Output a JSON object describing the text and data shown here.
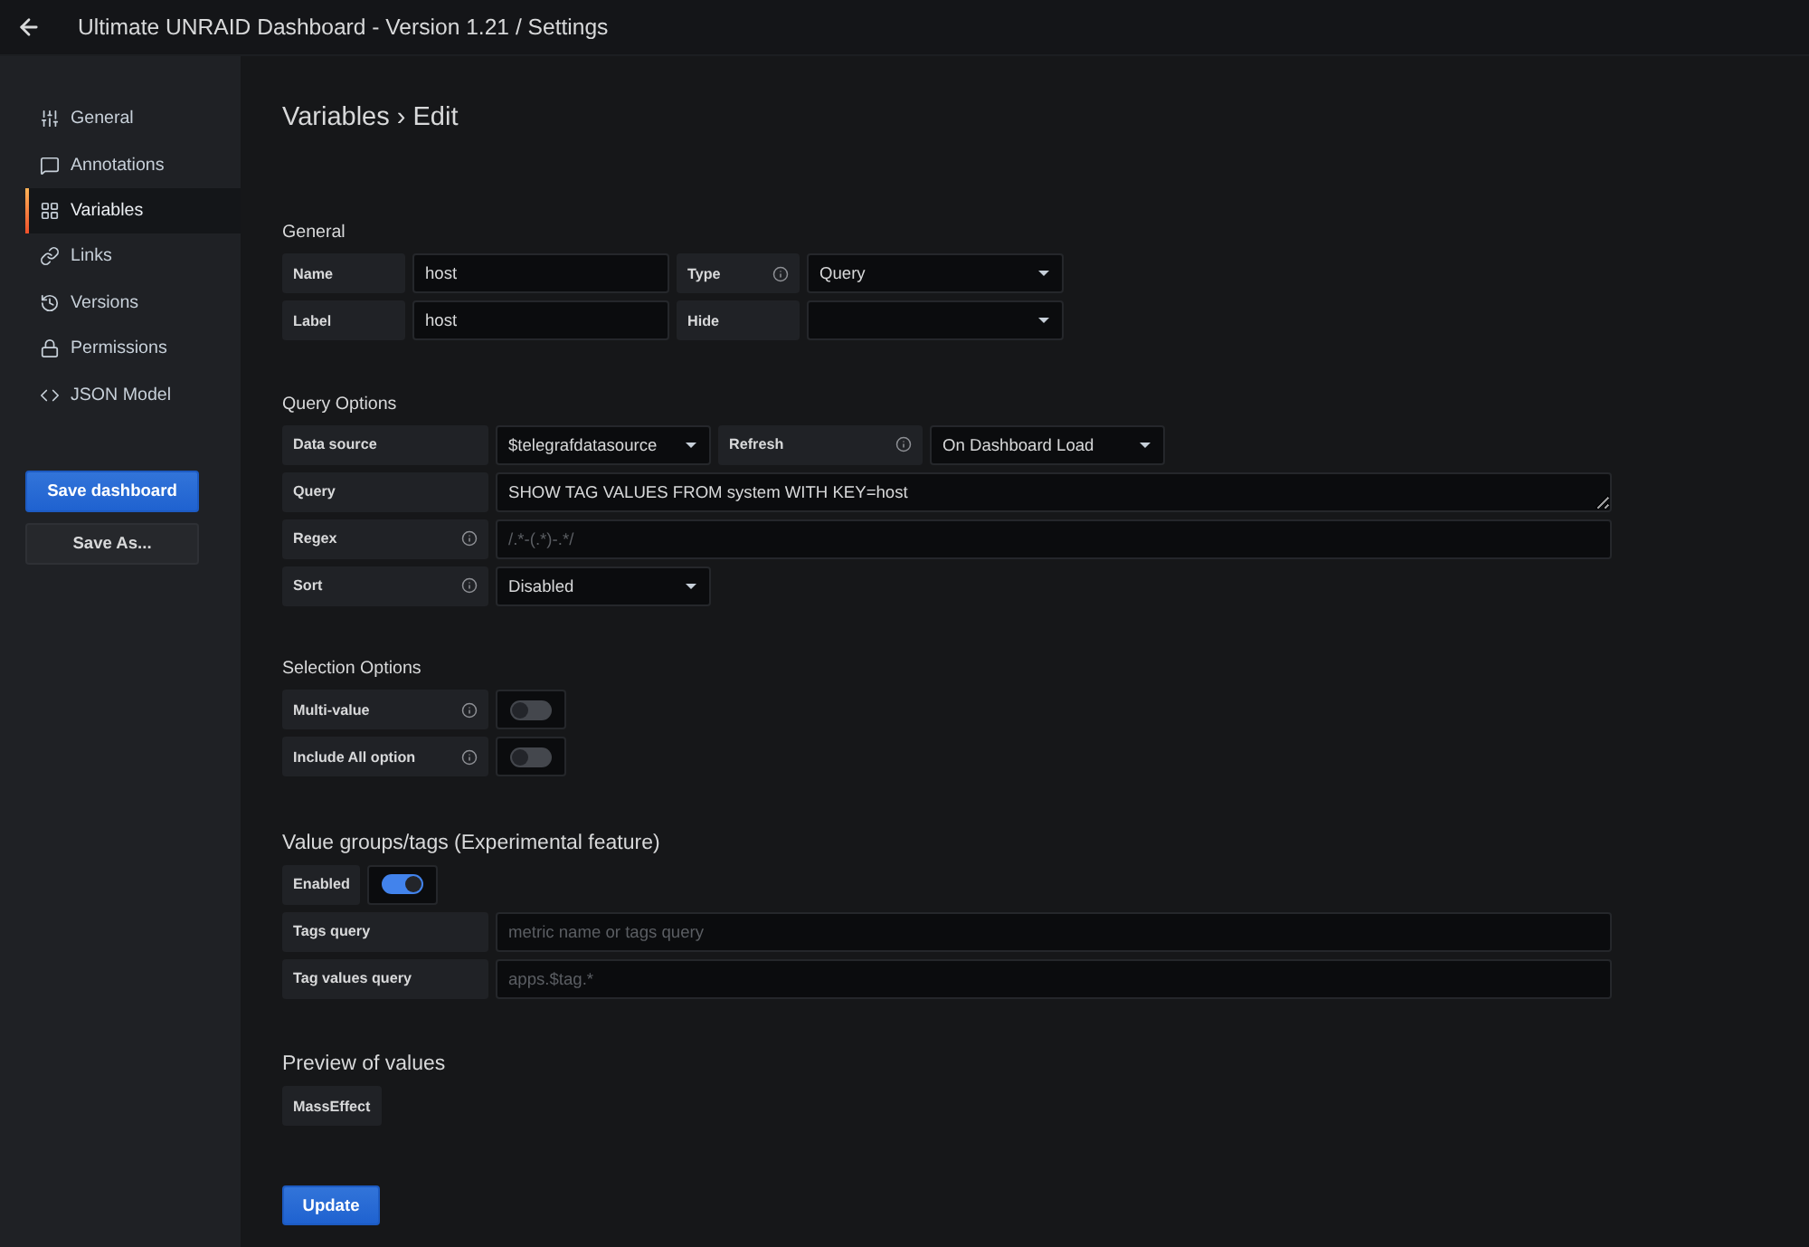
{
  "header": {
    "title": "Ultimate UNRAID Dashboard - Version 1.21 / Settings"
  },
  "sidebar": {
    "items": [
      {
        "label": "General",
        "selected": false
      },
      {
        "label": "Annotations",
        "selected": false
      },
      {
        "label": "Variables",
        "selected": true
      },
      {
        "label": "Links",
        "selected": false
      },
      {
        "label": "Versions",
        "selected": false
      },
      {
        "label": "Permissions",
        "selected": false
      },
      {
        "label": "JSON Model",
        "selected": false
      }
    ],
    "actions": [
      {
        "label": "Save dashboard",
        "kind": "primary"
      },
      {
        "label": "Save As...",
        "kind": "secondary"
      }
    ]
  },
  "page_title": "Variables › Edit",
  "sections": [
    {
      "title": "General",
      "rows": [
        {
          "fields": [
            {
              "kind": "label",
              "text": "Name",
              "info": false
            },
            {
              "kind": "input",
              "value": "host"
            },
            {
              "kind": "label",
              "text": "Type",
              "info": true
            },
            {
              "kind": "select",
              "value": "Query"
            }
          ]
        },
        {
          "fields": [
            {
              "kind": "label",
              "text": "Label",
              "info": false
            },
            {
              "kind": "input",
              "value": "host"
            },
            {
              "kind": "label",
              "text": "Hide",
              "info": false
            },
            {
              "kind": "select"
            }
          ]
        }
      ]
    },
    {
      "title": "Query Options",
      "rows": [
        {
          "fields": [
            {
              "kind": "label",
              "text": "Data source",
              "info": false
            },
            {
              "kind": "select",
              "value": "$telegrafdatasource"
            },
            {
              "kind": "label",
              "text": "Refresh",
              "info": true
            },
            {
              "kind": "select",
              "value": "On Dashboard Load"
            }
          ]
        },
        {
          "fields": [
            {
              "kind": "label",
              "text": "Query",
              "info": false
            },
            {
              "kind": "textarea",
              "value": "SHOW TAG VALUES FROM system WITH KEY=host"
            }
          ]
        },
        {
          "fields": [
            {
              "kind": "label",
              "text": "Regex",
              "info": true
            },
            {
              "kind": "input",
              "placeholder": "/.*-(.*)-.*/"
            }
          ]
        },
        {
          "fields": [
            {
              "kind": "label",
              "text": "Sort",
              "info": true
            },
            {
              "kind": "select",
              "value": "Disabled"
            }
          ]
        }
      ]
    },
    {
      "title": "Selection Options",
      "rows": [
        {
          "fields": [
            {
              "kind": "label",
              "text": "Multi-value",
              "info": true
            },
            {
              "kind": "switch",
              "on": false
            }
          ]
        },
        {
          "fields": [
            {
              "kind": "label",
              "text": "Include All option",
              "info": true
            },
            {
              "kind": "switch",
              "on": false
            }
          ]
        }
      ]
    },
    {
      "title": "Value groups/tags (Experimental feature)",
      "rows": [
        {
          "fields": [
            {
              "kind": "label",
              "text": "Enabled",
              "info": false
            },
            {
              "kind": "switch",
              "on": true
            }
          ]
        },
        {
          "fields": [
            {
              "kind": "label",
              "text": "Tags query",
              "info": false
            },
            {
              "kind": "input",
              "placeholder": "metric name or tags query"
            }
          ]
        },
        {
          "fields": [
            {
              "kind": "label",
              "text": "Tag values query",
              "info": false
            },
            {
              "kind": "input",
              "placeholder": "apps.$tag.*"
            }
          ]
        }
      ]
    },
    {
      "title": "Preview of values",
      "rows": [
        {
          "fields": [
            {
              "kind": "chip",
              "text": "MassEffect"
            }
          ]
        }
      ]
    }
  ],
  "update_button": {
    "label": "Update"
  }
}
